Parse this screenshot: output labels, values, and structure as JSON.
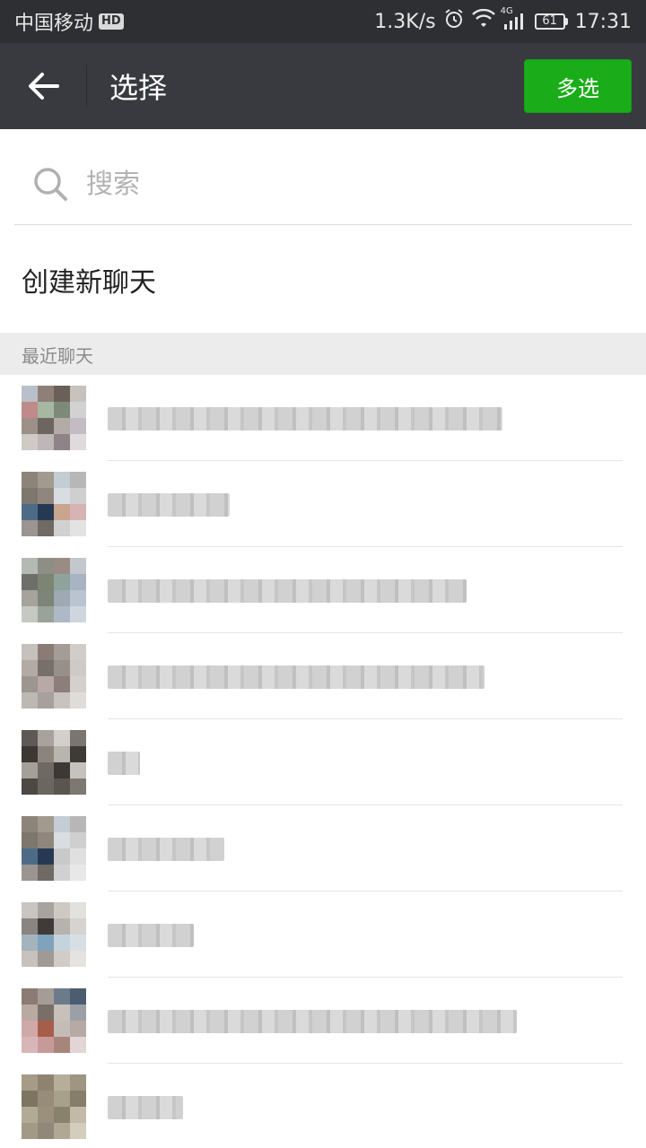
{
  "status_bar": {
    "carrier": "中国移动",
    "hd_badge": "HD",
    "net_speed": "1.3K/s",
    "network": "4G",
    "battery": "61",
    "time": "17:31"
  },
  "topbar": {
    "title": "选择",
    "multi_select_label": "多选"
  },
  "search": {
    "placeholder": "搜索",
    "value": ""
  },
  "create_chat_label": "创建新聊天",
  "section_header": "最近聊天",
  "colors": {
    "accent_green": "#1aad19",
    "topbar_bg": "#393a3f",
    "statusbar_bg": "#2e2f33"
  },
  "recent_chats": [
    {
      "name_width": 440,
      "avatar": [
        "#b9c0c9",
        "#8f7f78",
        "#6b5f59",
        "#c7c2bc",
        "#c08a8a",
        "#a7b8a0",
        "#7d8a7a",
        "#d2d2d2",
        "#9c9087",
        "#6e6560",
        "#b3aba6",
        "#c4bcc4",
        "#d0cac6",
        "#bfb6b8",
        "#8e8487",
        "#e0dadd"
      ]
    },
    {
      "name_width": 136,
      "avatar": [
        "#8c8478",
        "#a29a8f",
        "#c4ccd4",
        "#b7b7b7",
        "#7d776e",
        "#90867d",
        "#d8dde2",
        "#cfcfcf",
        "#4d6b86",
        "#253a52",
        "#c9a58d",
        "#d8b3b3",
        "#9a9590",
        "#6f6a64",
        "#d1d1d1",
        "#e3e3e3"
      ]
    },
    {
      "name_width": 400,
      "avatar": [
        "#b4bab3",
        "#8d8f86",
        "#9a8b84",
        "#c2c8cc",
        "#6e6f69",
        "#7b8571",
        "#8ea39b",
        "#a8b4c2",
        "#a6a29c",
        "#7d8478",
        "#9fa9b4",
        "#b8c4d2",
        "#c5c8c3",
        "#9aa39a",
        "#aeb8c6",
        "#d0d6de"
      ]
    },
    {
      "name_width": 420,
      "avatar": [
        "#c6c1bc",
        "#8a7c75",
        "#a49c96",
        "#d1cdca",
        "#b3aaa5",
        "#77706a",
        "#968f8a",
        "#cfcac6",
        "#9c9691",
        "#b8a9a6",
        "#8b7e7b",
        "#d6d0cd",
        "#bdb8b4",
        "#a7a09b",
        "#c9c3bf",
        "#e0dcd9"
      ]
    },
    {
      "name_width": 36,
      "avatar": [
        "#5e5954",
        "#a7a29c",
        "#d2d0cc",
        "#7a756f",
        "#3b3733",
        "#8a847d",
        "#b8b4ae",
        "#3e3a36",
        "#a59f99",
        "#6e6963",
        "#3c3834",
        "#c6c2bd",
        "#4d4843",
        "#6b665f",
        "#5a554f",
        "#7d7871"
      ]
    },
    {
      "name_width": 130,
      "avatar": [
        "#8c8478",
        "#a29a8f",
        "#c4ccd4",
        "#b7b7b7",
        "#7d776e",
        "#90867d",
        "#d8dde2",
        "#cfcfcf",
        "#4d6b86",
        "#253a52",
        "#c9c9c9",
        "#e0e0e0",
        "#9a9590",
        "#6f6a64",
        "#d1d1d1",
        "#e8e8e8"
      ]
    },
    {
      "name_width": 96,
      "avatar": [
        "#c9c6c2",
        "#a7a39f",
        "#cfc9c3",
        "#e3e1de",
        "#8a8581",
        "#3e3b38",
        "#b6b2ae",
        "#d6d3d0",
        "#a5b3bc",
        "#7fa3bb",
        "#c5d3dc",
        "#d8dfe4",
        "#c7c2bd",
        "#9f9a95",
        "#d2ccc7",
        "#e5e2df"
      ]
    },
    {
      "name_width": 456,
      "avatar": [
        "#8a7c75",
        "#a49c96",
        "#6d7a8a",
        "#4c5d70",
        "#b8aaa3",
        "#7b6e68",
        "#c7c0bb",
        "#9aa0a6",
        "#d1a8a8",
        "#a65e4a",
        "#c4bdb7",
        "#b7aaa4",
        "#d8b5b8",
        "#c79a9a",
        "#a8857a",
        "#e3d5d5"
      ]
    },
    {
      "name_width": 84,
      "avatar": [
        "#a59b86",
        "#8d836f",
        "#b7ae9a",
        "#9e9582",
        "#7d7461",
        "#968c78",
        "#a9a08c",
        "#867d6a",
        "#b3aa96",
        "#9a907c",
        "#8a816d",
        "#c2baa7",
        "#a39a86",
        "#91887a",
        "#b0a794",
        "#d4cdbd"
      ]
    }
  ]
}
